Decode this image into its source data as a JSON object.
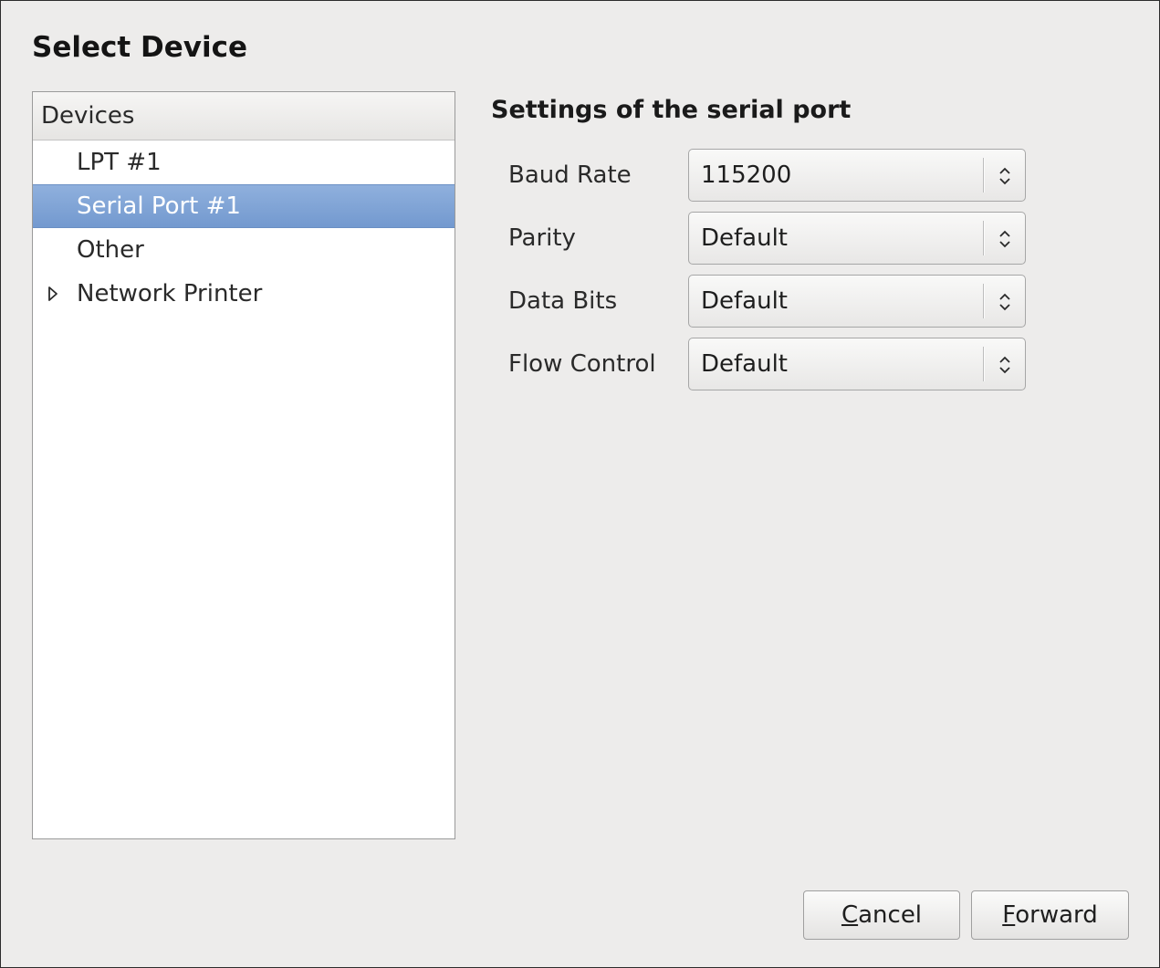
{
  "dialog": {
    "title": "Select Device"
  },
  "device_tree": {
    "header": "Devices",
    "items": [
      {
        "label": "LPT #1",
        "selected": false,
        "expandable": false
      },
      {
        "label": "Serial Port #1",
        "selected": true,
        "expandable": false
      },
      {
        "label": "Other",
        "selected": false,
        "expandable": false
      },
      {
        "label": "Network Printer",
        "selected": false,
        "expandable": true
      }
    ]
  },
  "settings": {
    "title": "Settings of the serial port",
    "fields": [
      {
        "label": "Baud Rate",
        "value": "115200"
      },
      {
        "label": "Parity",
        "value": "Default"
      },
      {
        "label": "Data Bits",
        "value": "Default"
      },
      {
        "label": "Flow Control",
        "value": "Default"
      }
    ]
  },
  "buttons": {
    "cancel": {
      "mnemonic": "C",
      "rest": "ancel"
    },
    "forward": {
      "mnemonic": "F",
      "rest": "orward"
    }
  },
  "colors": {
    "selection": "#7aa0d4",
    "background": "#edeceb"
  },
  "icons": {
    "expander": "triangle-right-icon",
    "combo_arrow": "up-down-arrows-icon"
  }
}
